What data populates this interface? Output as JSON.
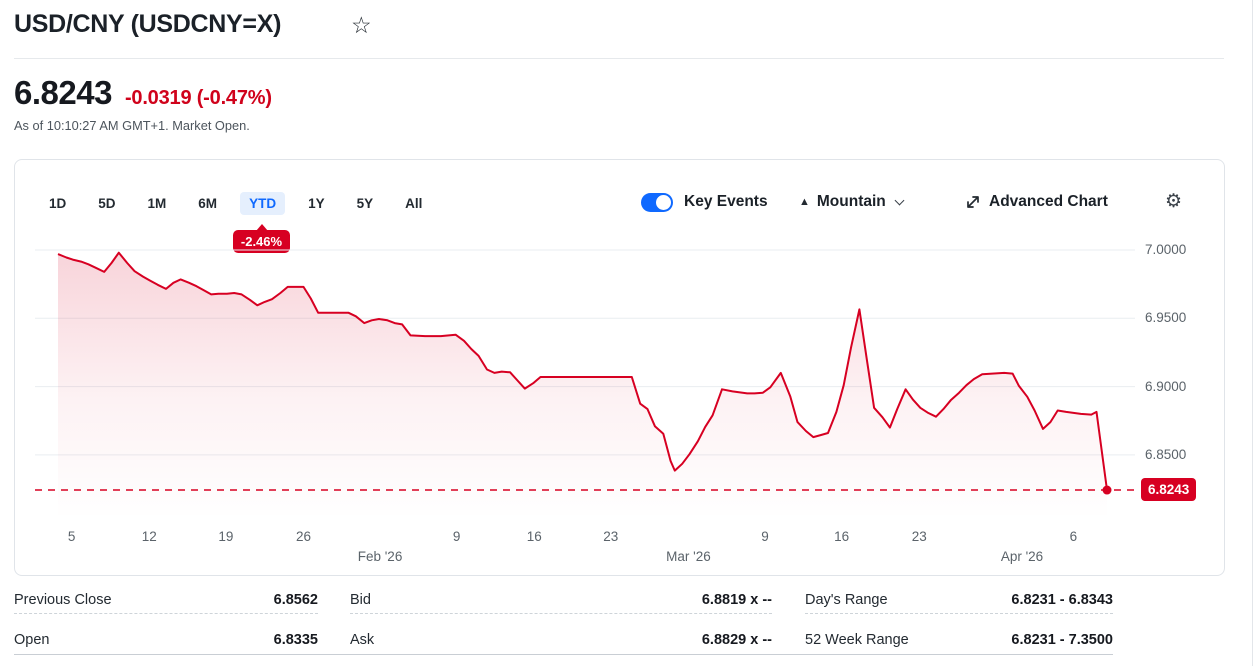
{
  "header": {
    "title": "USD/CNY (USDCNY=X)",
    "price": "6.8243",
    "change": "-0.0319 (-0.47%)",
    "as_of": "As of 10:10:27 AM GMT+1. Market Open."
  },
  "toolbar": {
    "ranges": [
      {
        "label": "1D",
        "active": false
      },
      {
        "label": "5D",
        "active": false
      },
      {
        "label": "1M",
        "active": false
      },
      {
        "label": "6M",
        "active": false
      },
      {
        "label": "YTD",
        "active": true
      },
      {
        "label": "1Y",
        "active": false
      },
      {
        "label": "5Y",
        "active": false
      },
      {
        "label": "All",
        "active": false
      }
    ],
    "ytd_change_badge": "-2.46%",
    "key_events_label": "Key Events",
    "key_events_on": true,
    "chart_type_label": "Mountain",
    "advanced_chart_label": "Advanced Chart"
  },
  "colors": {
    "down_red": "#d0021b",
    "line_red": "#d70022",
    "accent_blue": "#0f69ff",
    "grid": "#e9edf0"
  },
  "chart_data": {
    "type": "area",
    "title": "USD/CNY YTD price",
    "ylim": [
      6.8,
      7.01
    ],
    "grid": true,
    "y_ticks": [
      7.0,
      6.95,
      6.9,
      6.85
    ],
    "y_tick_labels": [
      "7.0000",
      "6.9500",
      "6.9000",
      "6.8500"
    ],
    "current_price": 6.8243,
    "current_price_label": "6.8243",
    "x_ticks": [
      {
        "frac": 0.013,
        "label": "5"
      },
      {
        "frac": 0.087,
        "label": "12"
      },
      {
        "frac": 0.16,
        "label": "19"
      },
      {
        "frac": 0.234,
        "label": "26"
      },
      {
        "frac": 0.38,
        "label": "9"
      },
      {
        "frac": 0.454,
        "label": "16"
      },
      {
        "frac": 0.527,
        "label": "23"
      },
      {
        "frac": 0.674,
        "label": "9"
      },
      {
        "frac": 0.747,
        "label": "16"
      },
      {
        "frac": 0.821,
        "label": "23"
      },
      {
        "frac": 0.968,
        "label": "6"
      }
    ],
    "x_month_ticks": [
      {
        "frac": 0.307,
        "label": "Feb '26"
      },
      {
        "frac": 0.601,
        "label": "Mar '26"
      },
      {
        "frac": 0.919,
        "label": "Apr '26"
      }
    ],
    "series": [
      {
        "name": "USD/CNY",
        "points": [
          [
            0.0,
            6.997
          ],
          [
            0.008,
            6.9945
          ],
          [
            0.014,
            6.993
          ],
          [
            0.022,
            6.9915
          ],
          [
            0.029,
            6.9895
          ],
          [
            0.036,
            6.987
          ],
          [
            0.044,
            6.984
          ],
          [
            0.051,
            6.9905
          ],
          [
            0.058,
            6.998
          ],
          [
            0.066,
            6.9905
          ],
          [
            0.073,
            6.9845
          ],
          [
            0.081,
            6.9805
          ],
          [
            0.088,
            6.9775
          ],
          [
            0.095,
            6.9745
          ],
          [
            0.103,
            6.9715
          ],
          [
            0.11,
            6.976
          ],
          [
            0.117,
            6.9785
          ],
          [
            0.125,
            6.976
          ],
          [
            0.132,
            6.9735
          ],
          [
            0.139,
            6.9705
          ],
          [
            0.146,
            6.9675
          ],
          [
            0.153,
            6.968
          ],
          [
            0.161,
            6.968
          ],
          [
            0.168,
            6.9685
          ],
          [
            0.175,
            6.9675
          ],
          [
            0.183,
            6.9635
          ],
          [
            0.19,
            6.9595
          ],
          [
            0.197,
            6.962
          ],
          [
            0.204,
            6.964
          ],
          [
            0.212,
            6.9685
          ],
          [
            0.219,
            6.973
          ],
          [
            0.234,
            6.973
          ],
          [
            0.241,
            6.9645
          ],
          [
            0.248,
            6.954
          ],
          [
            0.263,
            6.954
          ],
          [
            0.277,
            6.954
          ],
          [
            0.284,
            6.9515
          ],
          [
            0.292,
            6.9465
          ],
          [
            0.299,
            6.9485
          ],
          [
            0.306,
            6.9495
          ],
          [
            0.314,
            6.9485
          ],
          [
            0.321,
            6.9465
          ],
          [
            0.328,
            6.9455
          ],
          [
            0.336,
            6.9375
          ],
          [
            0.35,
            6.937
          ],
          [
            0.365,
            6.937
          ],
          [
            0.379,
            6.938
          ],
          [
            0.387,
            6.9335
          ],
          [
            0.394,
            6.9275
          ],
          [
            0.401,
            6.9225
          ],
          [
            0.409,
            6.9125
          ],
          [
            0.416,
            6.91
          ],
          [
            0.423,
            6.911
          ],
          [
            0.431,
            6.9105
          ],
          [
            0.438,
            6.9045
          ],
          [
            0.445,
            6.8985
          ],
          [
            0.453,
            6.9025
          ],
          [
            0.46,
            6.907
          ],
          [
            0.504,
            6.907
          ],
          [
            0.547,
            6.907
          ],
          [
            0.555,
            6.8875
          ],
          [
            0.562,
            6.8835
          ],
          [
            0.569,
            6.871
          ],
          [
            0.577,
            6.8655
          ],
          [
            0.584,
            6.8455
          ],
          [
            0.588,
            6.8385
          ],
          [
            0.595,
            6.8435
          ],
          [
            0.602,
            6.8505
          ],
          [
            0.61,
            6.86
          ],
          [
            0.617,
            6.8705
          ],
          [
            0.624,
            6.879
          ],
          [
            0.633,
            6.898
          ],
          [
            0.643,
            6.8965
          ],
          [
            0.657,
            6.895
          ],
          [
            0.664,
            6.895
          ],
          [
            0.672,
            6.8955
          ],
          [
            0.679,
            6.8995
          ],
          [
            0.689,
            6.91
          ],
          [
            0.698,
            6.893
          ],
          [
            0.705,
            6.874
          ],
          [
            0.713,
            6.8675
          ],
          [
            0.72,
            6.863
          ],
          [
            0.727,
            6.8645
          ],
          [
            0.734,
            6.866
          ],
          [
            0.742,
            6.8815
          ],
          [
            0.749,
            6.901
          ],
          [
            0.756,
            6.9285
          ],
          [
            0.764,
            6.9565
          ],
          [
            0.771,
            6.92
          ],
          [
            0.778,
            6.8845
          ],
          [
            0.786,
            6.8775
          ],
          [
            0.793,
            6.87
          ],
          [
            0.8,
            6.8835
          ],
          [
            0.808,
            6.898
          ],
          [
            0.815,
            6.8905
          ],
          [
            0.822,
            6.8845
          ],
          [
            0.829,
            6.881
          ],
          [
            0.837,
            6.878
          ],
          [
            0.844,
            6.8835
          ],
          [
            0.851,
            6.89
          ],
          [
            0.859,
            6.8955
          ],
          [
            0.866,
            6.901
          ],
          [
            0.873,
            6.9055
          ],
          [
            0.881,
            6.909
          ],
          [
            0.902,
            6.91
          ],
          [
            0.91,
            6.9095
          ],
          [
            0.916,
            6.9005
          ],
          [
            0.924,
            6.8925
          ],
          [
            0.931,
            6.8825
          ],
          [
            0.939,
            6.869
          ],
          [
            0.946,
            6.874
          ],
          [
            0.953,
            6.8825
          ],
          [
            0.961,
            6.8815
          ],
          [
            0.975,
            6.88
          ],
          [
            0.985,
            6.8795
          ],
          [
            0.99,
            6.8815
          ],
          [
            1.0,
            6.8243
          ]
        ]
      }
    ]
  },
  "stats": {
    "rows": [
      {
        "cells": [
          {
            "label": "Previous Close",
            "value": "6.8562"
          },
          {
            "label": "Bid",
            "value": "6.8819 x --"
          },
          {
            "label": "Day's Range",
            "value": "6.8231 - 6.8343"
          }
        ]
      },
      {
        "cells": [
          {
            "label": "Open",
            "value": "6.8335"
          },
          {
            "label": "Ask",
            "value": "6.8829 x --"
          },
          {
            "label": "52 Week Range",
            "value": "6.8231 - 7.3500"
          }
        ]
      }
    ]
  }
}
